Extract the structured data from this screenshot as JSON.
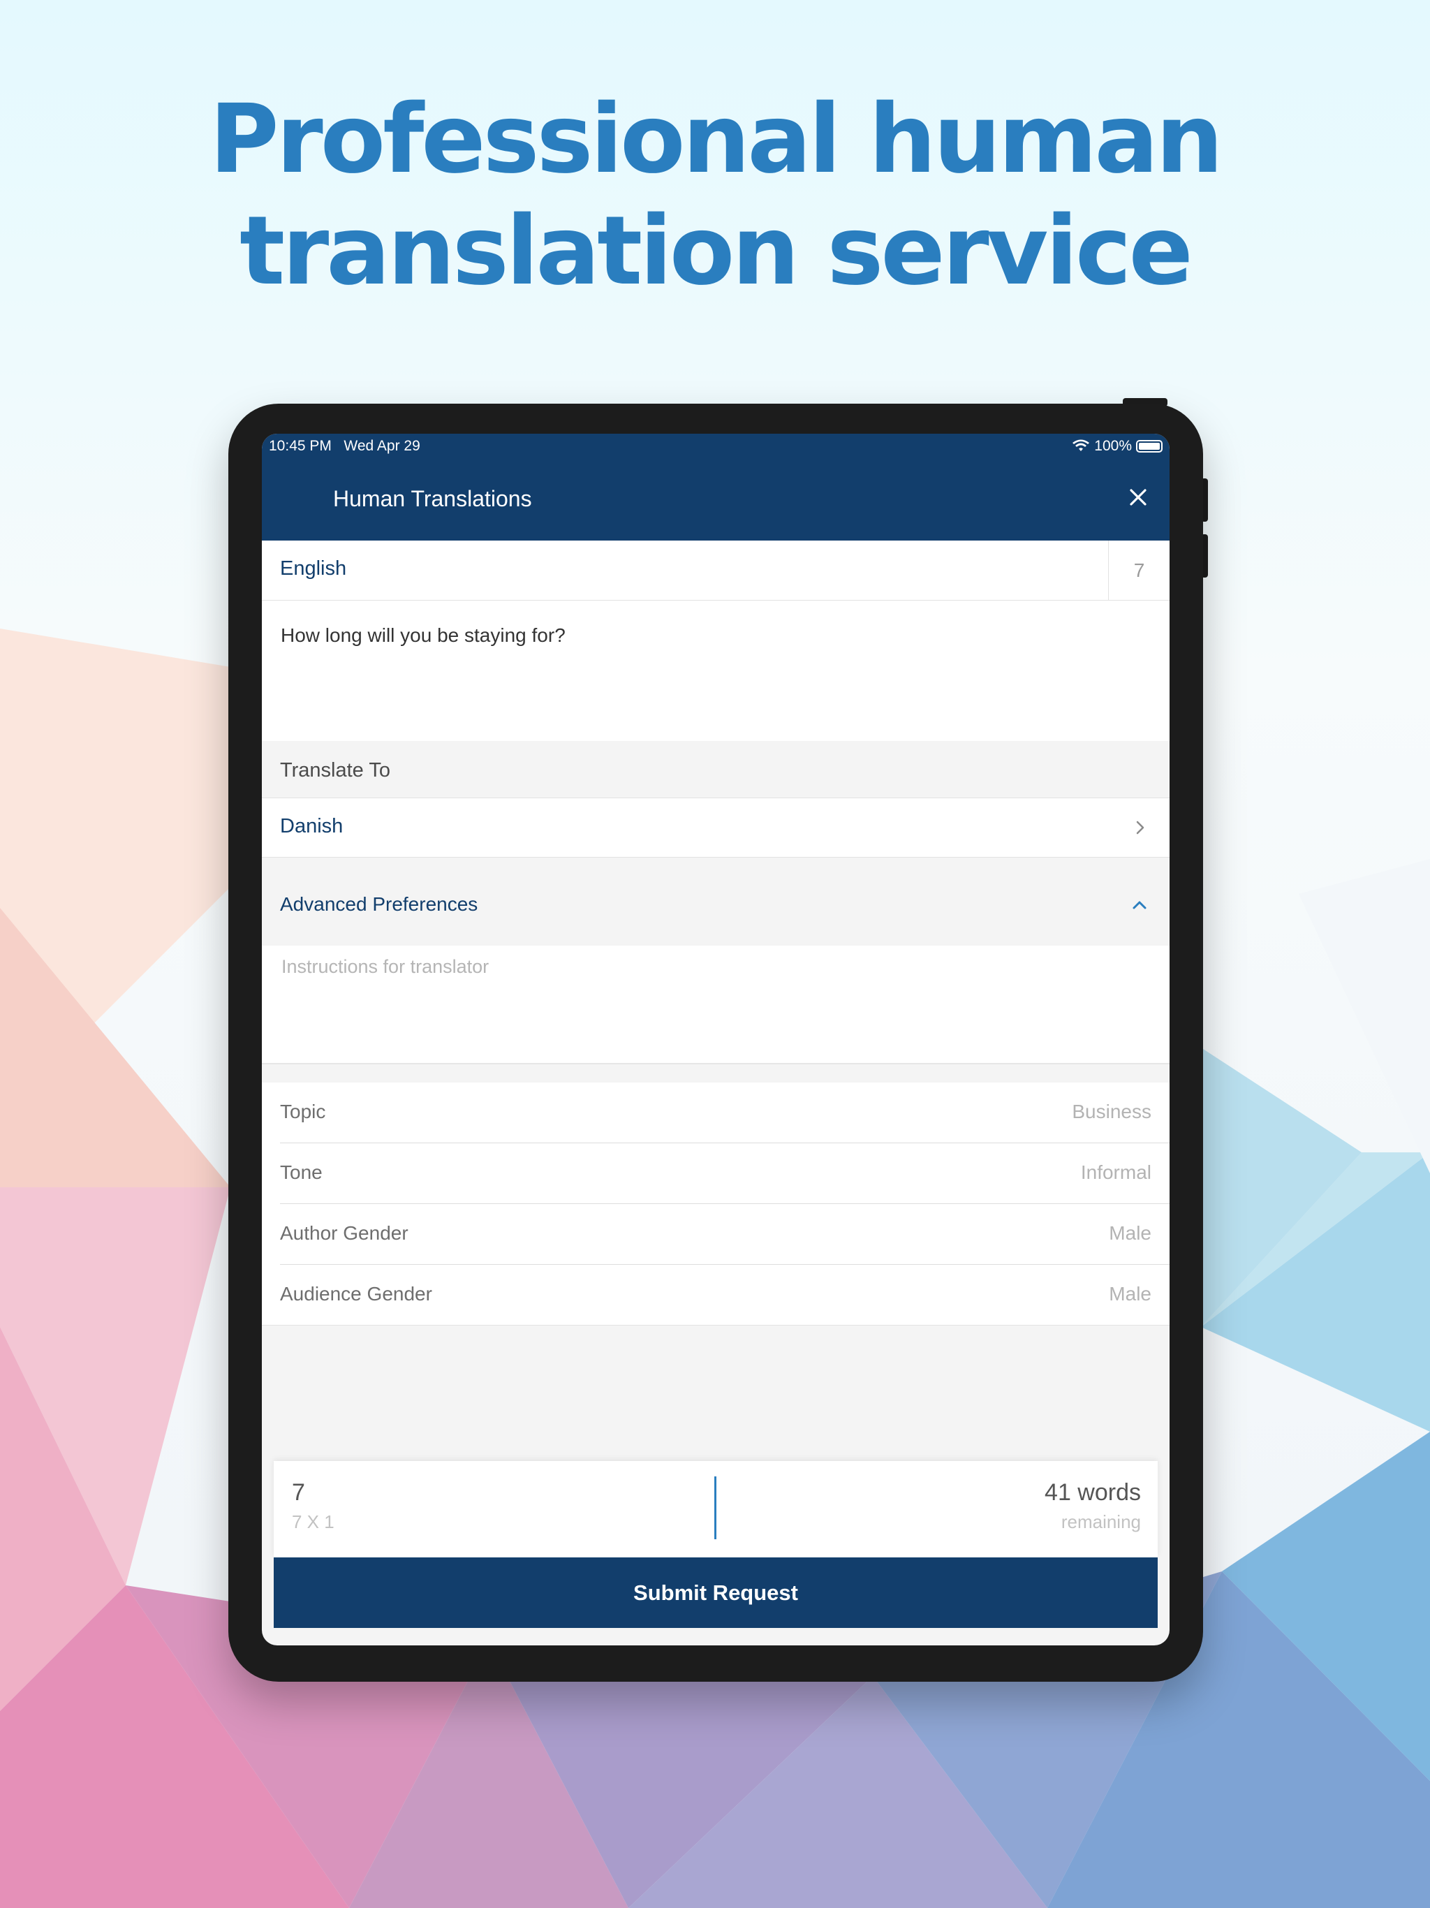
{
  "headline": {
    "line1": "Professional human",
    "line2": "translation service"
  },
  "colors": {
    "brand_navy": "#123e6c",
    "headline_blue": "#2a7ebf",
    "accent_blue": "#2a7ebf"
  },
  "status_bar": {
    "time": "10:45 PM",
    "date": "Wed Apr 29",
    "battery": "100%",
    "icons": [
      "wifi-icon",
      "battery-icon"
    ]
  },
  "header": {
    "title": "Human Translations",
    "close_icon": "close-icon"
  },
  "source": {
    "language": "English",
    "word_count": "7",
    "text": "How long will you be staying for?"
  },
  "target": {
    "section_label": "Translate To",
    "language": "Danish"
  },
  "advanced": {
    "label": "Advanced Preferences",
    "instructions_placeholder": "Instructions for translator"
  },
  "preferences": [
    {
      "name": "Topic",
      "value": "Business"
    },
    {
      "name": "Tone",
      "value": "Informal"
    },
    {
      "name": "Author Gender",
      "value": "Male"
    },
    {
      "name": "Audience Gender",
      "value": "Male"
    }
  ],
  "summary": {
    "count": "7",
    "formula": "7 X 1",
    "words": "41 words",
    "remaining": "remaining"
  },
  "submit_label": "Submit Request"
}
